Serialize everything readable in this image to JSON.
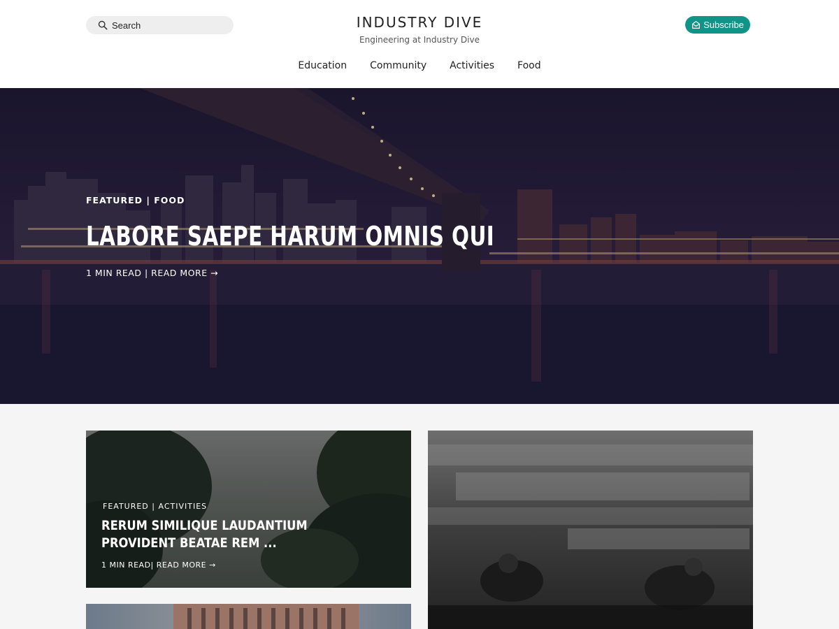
{
  "header": {
    "search_label": "Search",
    "site_title": "INDUSTRY DIVE",
    "site_subtitle": "Engineering at Industry Dive",
    "subscribe_label": "Subscribe"
  },
  "nav": {
    "items": [
      {
        "label": "Education"
      },
      {
        "label": "Community"
      },
      {
        "label": "Activities"
      },
      {
        "label": "Food"
      }
    ]
  },
  "hero": {
    "meta": "FEATURED | FOOD",
    "title": "LABORE SAEPE HARUM OMNIS QUI",
    "read_time": "1 MIN READ",
    "separator": "|",
    "read_more": "READ MORE →"
  },
  "cards": [
    {
      "meta": "FEATURED | ACTIVITIES",
      "title": "RERUM SIMILIQUE LAUDANTIUM PROVIDENT BEATAE REM ...",
      "read_time": "1 MIN READ",
      "separator": "|",
      "read_more": "READ MORE →"
    }
  ],
  "colors": {
    "accent": "#109488",
    "page_background": "#f5f5f5"
  }
}
